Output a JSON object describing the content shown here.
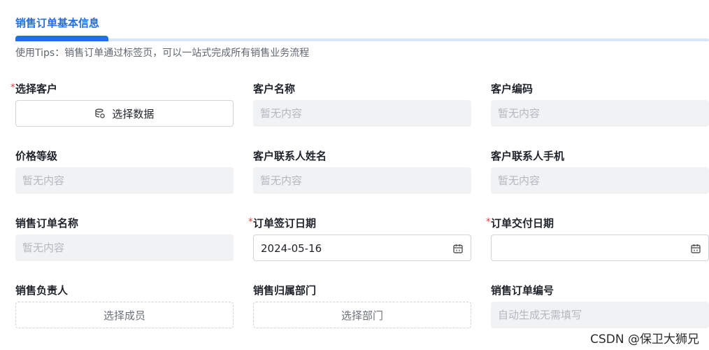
{
  "section": {
    "title": "销售订单基本信息",
    "tips": "使用Tips：销售订单通过标签页，可以一站式完成所有销售业务流程"
  },
  "fields": {
    "customer": {
      "label": "选择客户",
      "required_mark": "*",
      "button_label": "选择数据"
    },
    "customer_name": {
      "label": "客户名称",
      "placeholder": "暂无内容"
    },
    "customer_code": {
      "label": "客户编码",
      "placeholder": "暂无内容"
    },
    "price_level": {
      "label": "价格等级",
      "placeholder": "暂无内容"
    },
    "contact_name": {
      "label": "客户联系人姓名",
      "placeholder": "暂无内容"
    },
    "contact_phone": {
      "label": "客户联系人手机",
      "placeholder": "暂无内容"
    },
    "order_name": {
      "label": "销售订单名称",
      "placeholder": "暂无内容"
    },
    "sign_date": {
      "label": "订单签订日期",
      "required_mark": "*",
      "value": "2024-05-16"
    },
    "delivery_date": {
      "label": "订单交付日期",
      "required_mark": "*",
      "value": ""
    },
    "owner": {
      "label": "销售负责人",
      "button_label": "选择成员"
    },
    "department": {
      "label": "销售归属部门",
      "button_label": "选择部门"
    },
    "order_no": {
      "label": "销售订单编号",
      "placeholder": "自动生成无需填写"
    }
  },
  "watermark": "CSDN @保卫大狮兄",
  "icons": {
    "select_data": "database-icon",
    "date": "calendar-icon"
  },
  "colors": {
    "accent": "#1f6fe5",
    "required": "#e23b3b",
    "readonly_bg": "#f1f2f4"
  }
}
